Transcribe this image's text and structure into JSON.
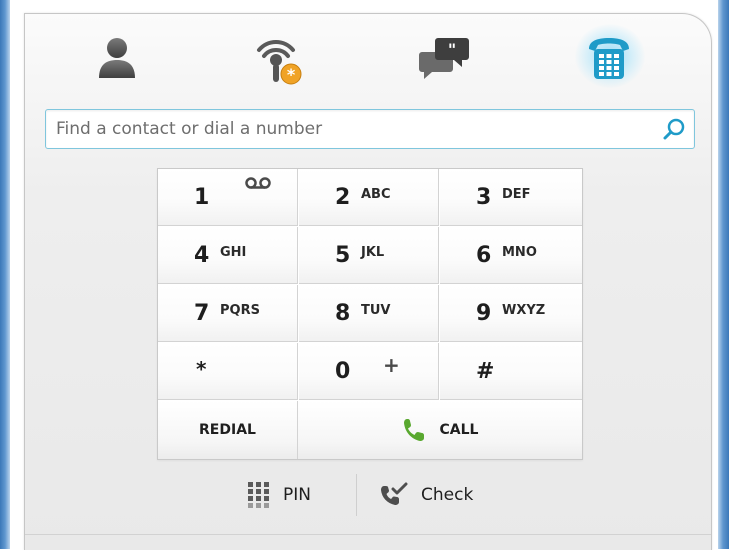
{
  "tabs": [
    {
      "id": "contacts",
      "icon": "contact-person-icon"
    },
    {
      "id": "presence",
      "icon": "presence-status-icon"
    },
    {
      "id": "chat",
      "icon": "conversation-bubbles-icon"
    },
    {
      "id": "phone",
      "icon": "phone-dialpad-icon",
      "selected": true
    }
  ],
  "search": {
    "placeholder": "Find a contact or dial a number",
    "value": "",
    "icon": "search-icon"
  },
  "keypad": {
    "keys": [
      {
        "digit": "1",
        "letters": "",
        "icon": "voicemail-icon"
      },
      {
        "digit": "2",
        "letters": "ABC"
      },
      {
        "digit": "3",
        "letters": "DEF"
      },
      {
        "digit": "4",
        "letters": "GHI"
      },
      {
        "digit": "5",
        "letters": "JKL"
      },
      {
        "digit": "6",
        "letters": "MNO"
      },
      {
        "digit": "7",
        "letters": "PQRS"
      },
      {
        "digit": "8",
        "letters": "TUV"
      },
      {
        "digit": "9",
        "letters": "WXYZ"
      },
      {
        "digit": "*",
        "letters": ""
      },
      {
        "digit": "0",
        "letters": "",
        "symbol": "+"
      },
      {
        "digit": "#",
        "letters": ""
      }
    ],
    "redial_label": "REDIAL",
    "call_label": "CALL"
  },
  "actions": {
    "pin_label": "PIN",
    "check_label": "Check"
  },
  "colors": {
    "accent_blue": "#1f9bc8",
    "call_green": "#59a82f",
    "presence_badge": "#f0a326",
    "icon_gray": "#5a5a5a"
  }
}
